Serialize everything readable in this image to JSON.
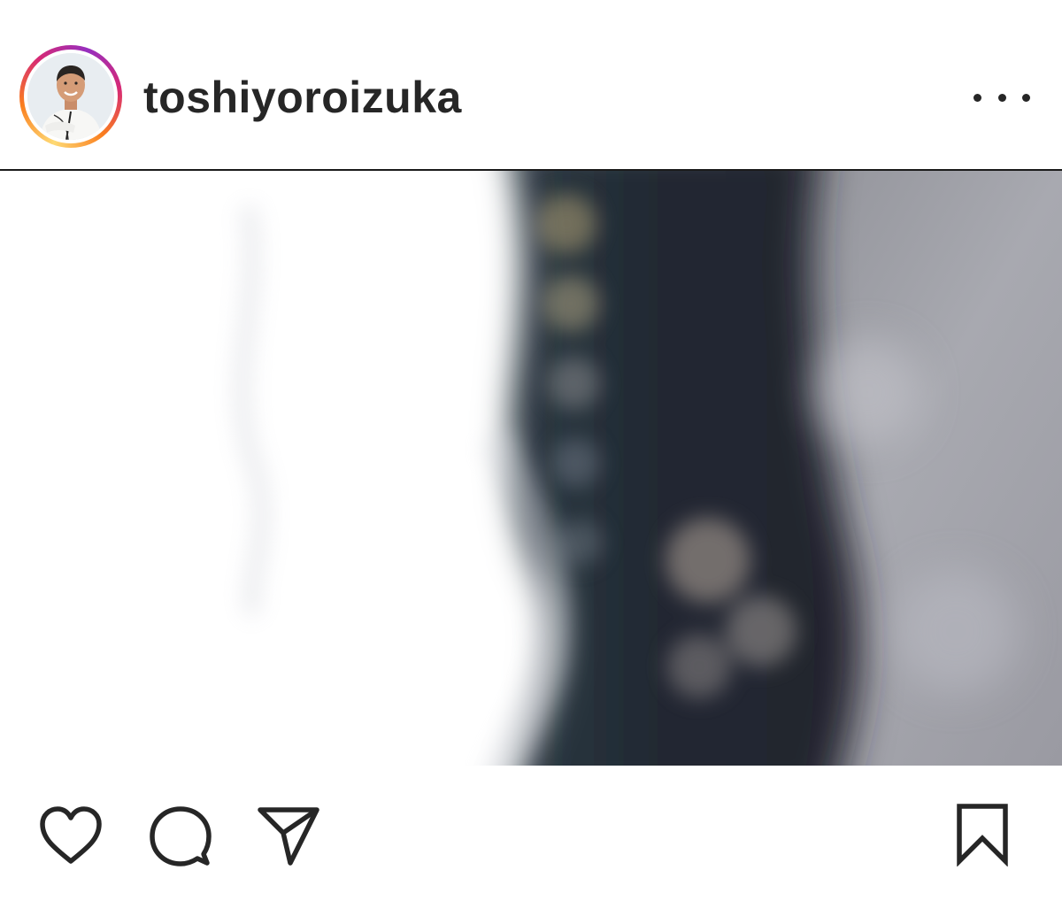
{
  "post": {
    "username": "toshiyoroizuka",
    "avatar_icon": "chef-profile-photo",
    "more_icon": "more-options-icon"
  },
  "media": {
    "description_icon": "blurred-photo"
  },
  "actions": {
    "like_icon": "heart-icon",
    "comment_icon": "comment-icon",
    "share_icon": "send-icon",
    "save_icon": "bookmark-icon"
  },
  "colors": {
    "text": "#262626",
    "ring_gradient": [
      "#feda75",
      "#fa7e1e",
      "#d62976",
      "#962fbf"
    ],
    "icon": "#262626"
  }
}
